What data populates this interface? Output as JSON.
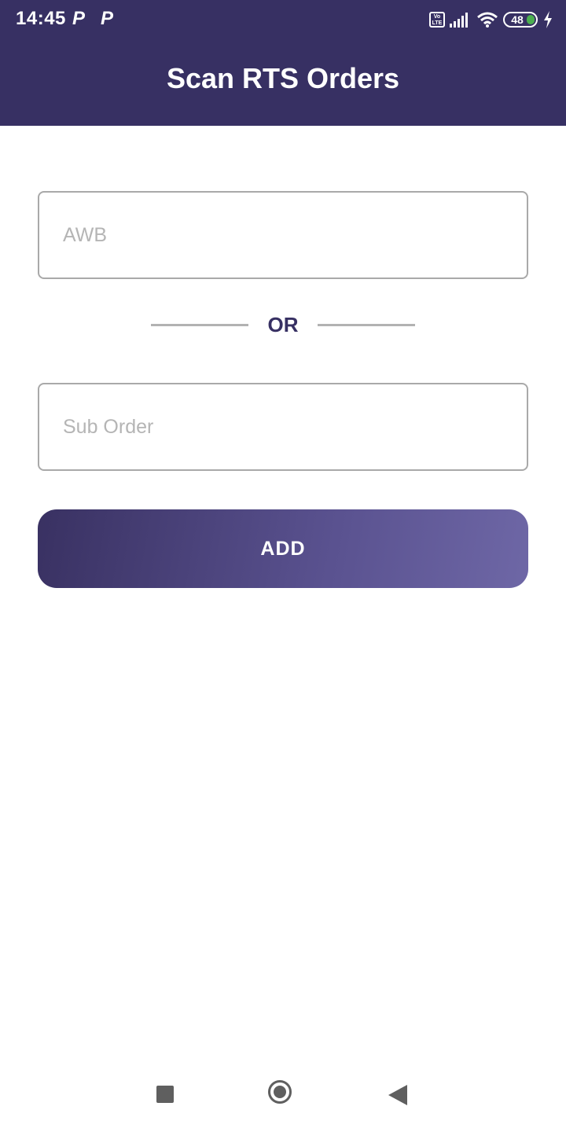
{
  "status_bar": {
    "time": "14:45",
    "notification_icons": [
      "p-icon",
      "p-icon"
    ],
    "p_label": "P",
    "volte_label": "Vo LTE",
    "battery_level": "48",
    "icons": [
      "volte-icon",
      "signal-icon",
      "wifi-icon",
      "battery-icon",
      "charging-icon"
    ]
  },
  "header": {
    "title": "Scan RTS Orders",
    "background_color": "#373063"
  },
  "form": {
    "awb_placeholder": "AWB",
    "awb_value": "",
    "divider_text": "OR",
    "sub_order_placeholder": "Sub Order",
    "sub_order_value": "",
    "add_button_label": "ADD"
  },
  "nav_bar": {
    "icons": [
      "recents-square-icon",
      "home-circle-icon",
      "back-triangle-icon"
    ]
  }
}
